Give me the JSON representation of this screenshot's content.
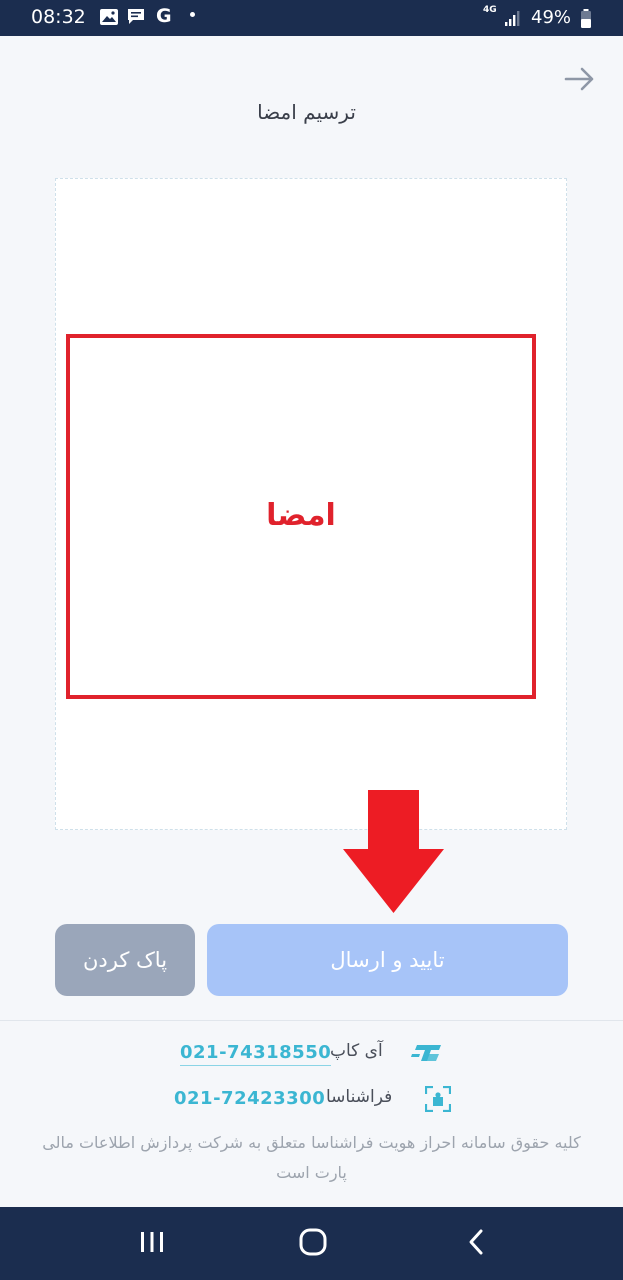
{
  "status_bar": {
    "time": "08:32",
    "network": "4G",
    "battery": "49%",
    "icons": [
      "image-icon",
      "message-icon",
      "google-icon",
      "notification-dot-icon",
      "signal-icon",
      "battery-icon"
    ]
  },
  "header": {
    "title": "ترسیم امضا",
    "back_icon": "arrow-right-icon"
  },
  "signature": {
    "label": "امضا"
  },
  "buttons": {
    "submit_label": "تایید و ارسال",
    "clear_label": "پاک کردن"
  },
  "footer": {
    "providers": [
      {
        "name": "آی کاپ",
        "phone": "021-74318550",
        "icon": "icap-logo-icon"
      },
      {
        "name": "فراشناسا",
        "phone": "021-72423300",
        "icon": "farashenasa-logo-icon"
      }
    ],
    "copyright": "کلیه حقوق سامانه احراز هویت فراشناسا متعلق به شرکت پردازش اطلاعات مالی پارت است"
  },
  "colors": {
    "status_bar": "#1b2d4f",
    "submit_button": "#a7c4f8",
    "clear_button": "#9aa6ba",
    "annotation_red": "#e0222c",
    "phone_link": "#3bb6d2"
  },
  "nav_bar": {
    "icons": [
      "recent-apps-icon",
      "home-icon",
      "back-icon"
    ]
  }
}
